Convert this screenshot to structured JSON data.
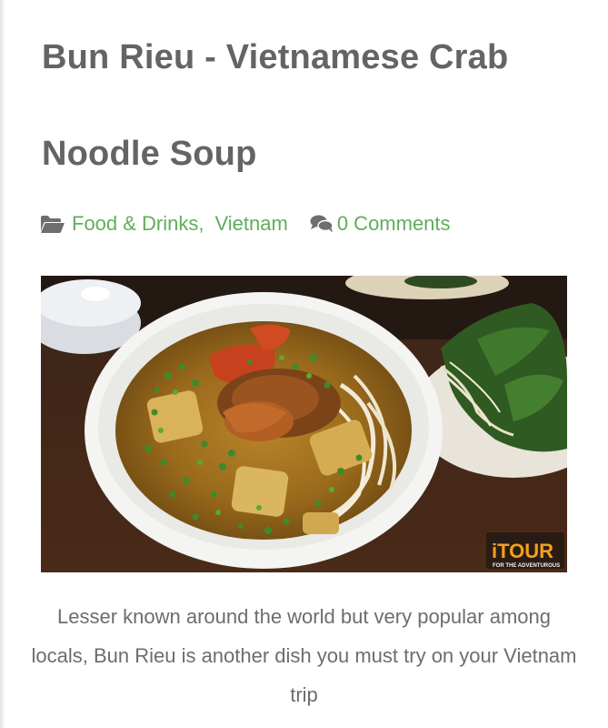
{
  "article": {
    "title": "Bun Rieu - Vietnamese Crab Noodle Soup",
    "categories": [
      {
        "label": "Food & Drinks"
      },
      {
        "label": "Vietnam"
      }
    ],
    "category_separator": ",",
    "comments_label": "0 Comments",
    "image": {
      "subject": "bowl of crab noodle soup with herbs",
      "watermark_brand": "iTOUR",
      "watermark_tagline": "FOR THE ADVENTUROUS"
    },
    "caption": "Lesser known around the world but very popular among locals, Bun Rieu is another dish you must try on your Vietnam trip"
  },
  "icons": {
    "category": "folder-open-icon",
    "comments": "comments-icon"
  },
  "colors": {
    "title": "#646464",
    "link": "#5fae5a",
    "body_text": "#6d6d6d"
  }
}
